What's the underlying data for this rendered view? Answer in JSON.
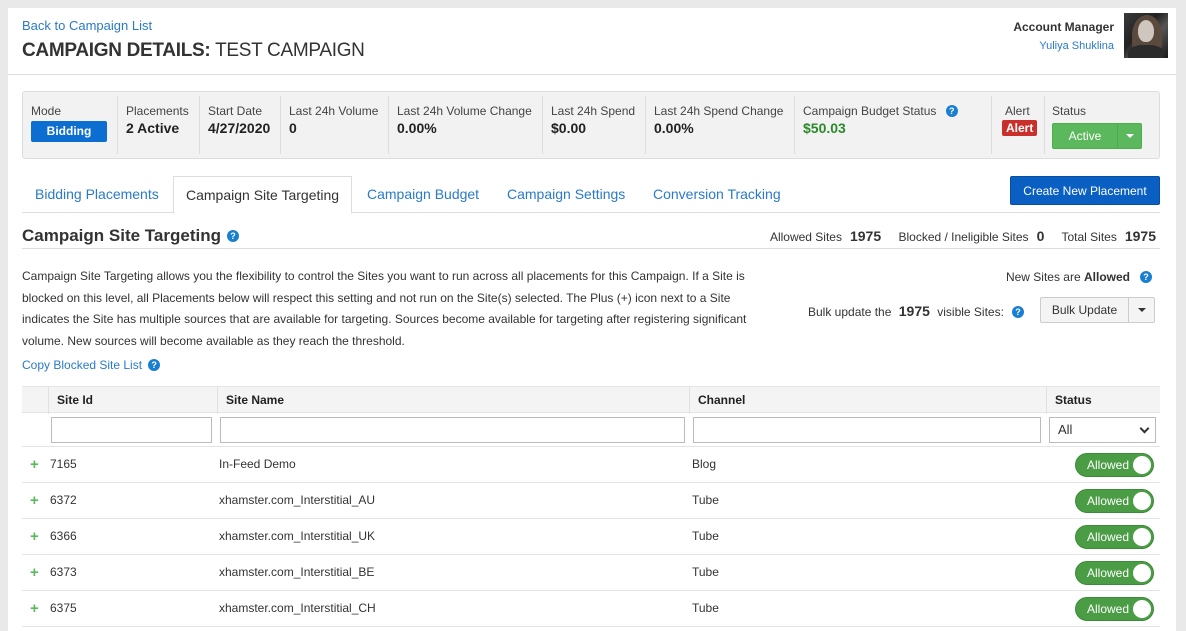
{
  "header": {
    "back_link": "Back to Campaign List",
    "title_prefix": "CAMPAIGN DETAILS:",
    "title_name": "TEST CAMPAIGN",
    "account_manager_label": "Account Manager",
    "account_manager_name": "Yuliya Shuklina"
  },
  "stats": {
    "mode": {
      "label": "Mode",
      "value": "Bidding"
    },
    "placements": {
      "label": "Placements",
      "value": "2 Active"
    },
    "start_date": {
      "label": "Start Date",
      "value": "4/27/2020"
    },
    "volume": {
      "label": "Last 24h Volume",
      "value": "0"
    },
    "volume_change": {
      "label": "Last 24h Volume Change",
      "value": "0.00%"
    },
    "spend": {
      "label": "Last 24h Spend",
      "value": "$0.00"
    },
    "spend_change": {
      "label": "Last 24h Spend Change",
      "value": "0.00%"
    },
    "budget_status": {
      "label": "Campaign Budget Status",
      "value": "$50.03"
    },
    "alert": {
      "label": "Alert",
      "value": "Alert"
    },
    "status": {
      "label": "Status",
      "value": "Active"
    }
  },
  "tabs": [
    {
      "label": "Bidding Placements"
    },
    {
      "label": "Campaign Site Targeting"
    },
    {
      "label": "Campaign Budget"
    },
    {
      "label": "Campaign Settings"
    },
    {
      "label": "Conversion Tracking"
    }
  ],
  "create_button": "Create New Placement",
  "section": {
    "title": "Campaign Site Targeting",
    "allowed_label": "Allowed Sites",
    "allowed_value": "1975",
    "blocked_label": "Blocked / Ineligible Sites",
    "blocked_value": "0",
    "total_label": "Total Sites",
    "total_value": "1975",
    "description": "Campaign Site Targeting allows you the flexibility to control the Sites you want to run across all placements for this Campaign. If a Site is blocked on this level, all Placements below will respect this setting and not run on the Site(s) selected. The Plus (+) icon next to a Site indicates the Site has multiple sources that are available for targeting. Sources become available for targeting after registering significant volume. New sources will become available as they reach the threshold.",
    "copy_link": "Copy Blocked Site List",
    "new_sites_prefix": "New Sites are",
    "new_sites_value": "Allowed",
    "bulk_prefix": "Bulk update the",
    "bulk_count": "1975",
    "bulk_suffix": "visible Sites:",
    "bulk_button": "Bulk Update"
  },
  "table": {
    "columns": [
      "Site Id",
      "Site Name",
      "Channel",
      "Status"
    ],
    "status_filter": "All",
    "rows": [
      {
        "id": "7165",
        "name": "In-Feed Demo",
        "channel": "Blog",
        "status": "Allowed"
      },
      {
        "id": "6372",
        "name": "xhamster.com_Interstitial_AU",
        "channel": "Tube",
        "status": "Allowed"
      },
      {
        "id": "6366",
        "name": "xhamster.com_Interstitial_UK",
        "channel": "Tube",
        "status": "Allowed"
      },
      {
        "id": "6373",
        "name": "xhamster.com_Interstitial_BE",
        "channel": "Tube",
        "status": "Allowed"
      },
      {
        "id": "6375",
        "name": "xhamster.com_Interstitial_CH",
        "channel": "Tube",
        "status": "Allowed"
      }
    ]
  },
  "icons": {
    "help": "?",
    "plus": "+"
  }
}
